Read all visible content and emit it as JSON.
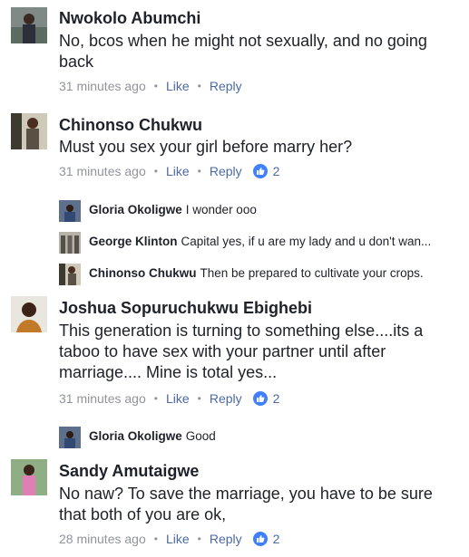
{
  "comments": [
    {
      "author": "Nwokolo Abumchi",
      "lines": [
        "No, bcos when he might not sexually, and no going",
        "back"
      ],
      "time": "31 minutes ago",
      "like": "Like",
      "reply": "Reply"
    },
    {
      "author": "Chinonso Chukwu",
      "lines": [
        "Must you sex your girl before marry her?"
      ],
      "time": "31 minutes ago",
      "like": "Like",
      "reply": "Reply",
      "reactions": "2",
      "replies": [
        {
          "author": "Gloria Okoligwe",
          "text": "I wonder ooo"
        },
        {
          "author": "George Klinton",
          "text": "Capital yes, if u are my lady and u don't wan..."
        },
        {
          "author": "Chinonso Chukwu",
          "text": "Then be prepared to cultivate your crops."
        }
      ]
    },
    {
      "author": "Joshua Sopuruchukwu Ebighebi",
      "lines": [
        "This generation is turning to something else....its a",
        "taboo to have sex with your partner until after",
        "marriage.... Mine is total yes..."
      ],
      "time": "31 minutes ago",
      "like": "Like",
      "reply": "Reply",
      "reactions": "2",
      "replies": [
        {
          "author": "Gloria Okoligwe",
          "text": "Good"
        }
      ]
    },
    {
      "author": "Sandy Amutaigwe",
      "lines": [
        "No naw? To save the marriage, you have to be sure",
        "that both of you are ok,"
      ],
      "time": "28 minutes ago",
      "like": "Like",
      "reply": "Reply",
      "reactions": "2"
    }
  ],
  "colors": {
    "link": "#4b6aa6",
    "meta": "#90949c",
    "like_badge": "#4080ff",
    "text": "#1d2129"
  },
  "icons": {
    "reaction": "thumbs-up-icon"
  }
}
